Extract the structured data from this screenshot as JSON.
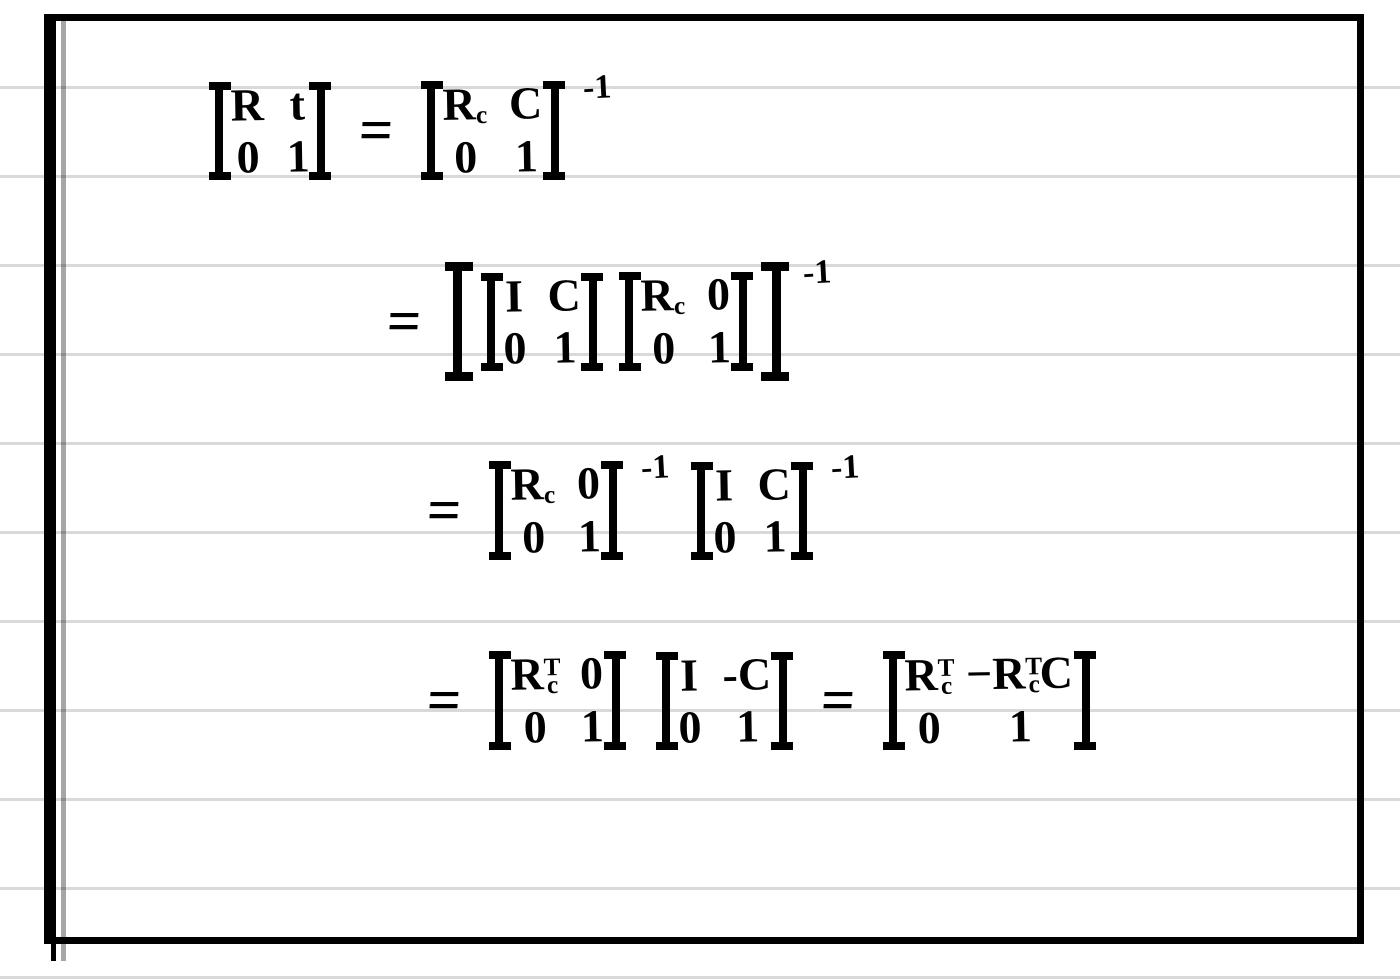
{
  "note": "Handwritten derivation of the inverse of a 4x4 camera-pose homogeneous matrix.",
  "line1": {
    "lhs": {
      "a": "R",
      "b": "t",
      "c": "0",
      "d": "1"
    },
    "rhs": {
      "a": "R_c",
      "b": "C",
      "c": "0",
      "d": "1",
      "exp": "-1"
    }
  },
  "line2": {
    "eq": "=",
    "factorA": {
      "a": "I",
      "b": "C",
      "c": "0",
      "d": "1"
    },
    "factorB": {
      "a": "R_c",
      "b": "0",
      "c": "0",
      "d": "1"
    },
    "outer_exp": "-1"
  },
  "line3": {
    "eq": "=",
    "factorA": {
      "a": "R_c",
      "b": "0",
      "c": "0",
      "d": "1",
      "exp": "-1"
    },
    "factorB": {
      "a": "I",
      "b": "C",
      "c": "0",
      "d": "1",
      "exp": "-1"
    }
  },
  "line4": {
    "eq": "=",
    "factorA": {
      "a": "R_c^T",
      "b": "0",
      "c": "0",
      "d": "1"
    },
    "factorB": {
      "a": "I",
      "b": "-C",
      "c": "0",
      "d": "1"
    },
    "eq2": "=",
    "result": {
      "a": "R_c^T",
      "b": "-R_c^T C",
      "c": "0",
      "d": "1"
    }
  }
}
